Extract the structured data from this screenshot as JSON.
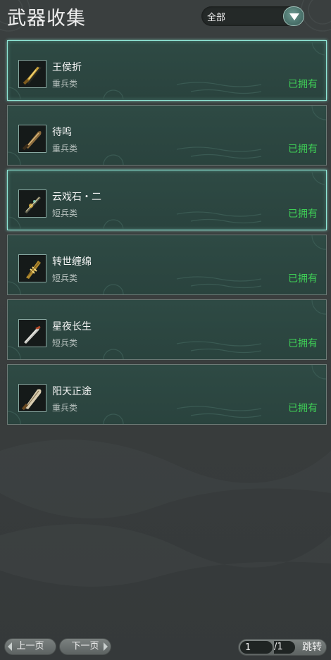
{
  "header": {
    "title": "武器收集",
    "filter_value": "全部"
  },
  "weapons": [
    {
      "name": "王侯折",
      "category": "重兵类",
      "status": "已拥有",
      "icon": "dark-gold-blade-icon"
    },
    {
      "name": "待鸣",
      "category": "重兵类",
      "status": "已拥有",
      "icon": "bronze-blade-icon"
    },
    {
      "name": "云戏石・二",
      "category": "短兵类",
      "status": "已拥有",
      "icon": "jeweled-dagger-icon"
    },
    {
      "name": "转世缠绵",
      "category": "短兵类",
      "status": "已拥有",
      "icon": "ornate-gold-dagger-icon"
    },
    {
      "name": "星夜长生",
      "category": "短兵类",
      "status": "已拥有",
      "icon": "silver-dagger-icon"
    },
    {
      "name": "阳天正途",
      "category": "重兵类",
      "status": "已拥有",
      "icon": "greatsword-icon"
    }
  ],
  "pagination": {
    "prev_label": "上一页",
    "next_label": "下一页",
    "current_page": "1",
    "total_pages": "/1",
    "jump_label": "跳转"
  },
  "colors": {
    "owned_text": "#3fcf56",
    "card_bg": "#2e4a44",
    "selected_border": "#8fe6d6"
  }
}
